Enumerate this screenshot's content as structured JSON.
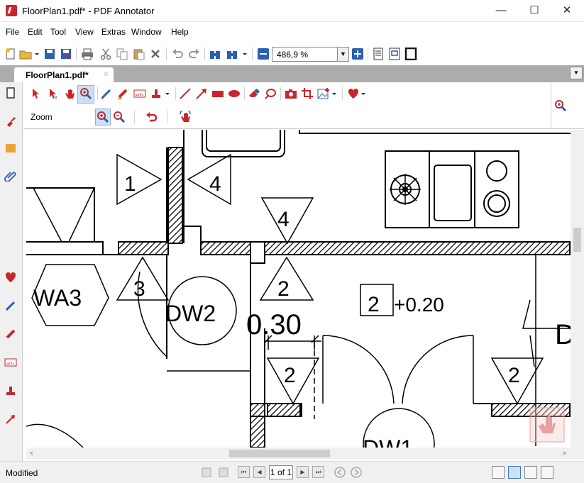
{
  "window": {
    "title": "FloorPlan1.pdf* - PDF Annotator",
    "minimize": "—",
    "maximize": "☐",
    "close": "✕"
  },
  "menu": [
    "File",
    "Edit",
    "Tool",
    "View",
    "Extras",
    "Window",
    "Help"
  ],
  "toolbar": {
    "zoom_value": "486,9 %",
    "icons": [
      "new-icon",
      "open-icon",
      "save-icon",
      "save-as-icon",
      "print-icon",
      "cut-icon",
      "copy-icon",
      "paste-icon",
      "delete-icon",
      "undo-icon",
      "redo-icon",
      "find-icon",
      "zoom-out-icon",
      "zoom-in-icon",
      "single-page-icon",
      "two-page-icon",
      "fullscreen-icon"
    ]
  },
  "tabs": {
    "active": "FloorPlan1.pdf*",
    "close": "✕",
    "menu": "▼"
  },
  "annotation_bar": {
    "mode_label": "Zoom",
    "icons": [
      "select-icon",
      "select-text-icon",
      "hand-icon",
      "zoom-tool-icon",
      "pen-icon",
      "highlighter-icon",
      "text-icon",
      "stamp-icon",
      "line-icon",
      "arrow-icon",
      "rectangle-icon",
      "ellipse-icon",
      "eraser-icon",
      "lasso-icon",
      "camera-icon",
      "crop-icon",
      "insert-image-icon",
      "favorites-heart-icon"
    ],
    "sub_icons": [
      "zoom-in-tool-icon",
      "zoom-out-tool-icon",
      "undo-zoom-icon",
      "annotate-hand-icon"
    ],
    "right_icon": "zoom-tool-icon"
  },
  "floorplan": {
    "labels": {
      "t1": "1",
      "t4a": "4",
      "t4b": "4",
      "t3": "3",
      "t2a": "2",
      "t2b": "2",
      "t2c": "2",
      "box2": "2",
      "offset": "+0.20",
      "hex": "WA3",
      "dw2": "DW2",
      "dim": "0.30",
      "dw1": "DW1",
      "d": "D"
    }
  },
  "status": {
    "text": "Modified",
    "page": "1 of 1",
    "nav": {
      "first": "⏮",
      "prev": "◀",
      "next": "▶",
      "last": "⏭"
    }
  },
  "colors": {
    "accent_red": "#c8262b",
    "accent_blue": "#2b5fb0",
    "status_bg": "#f0f0f0"
  }
}
